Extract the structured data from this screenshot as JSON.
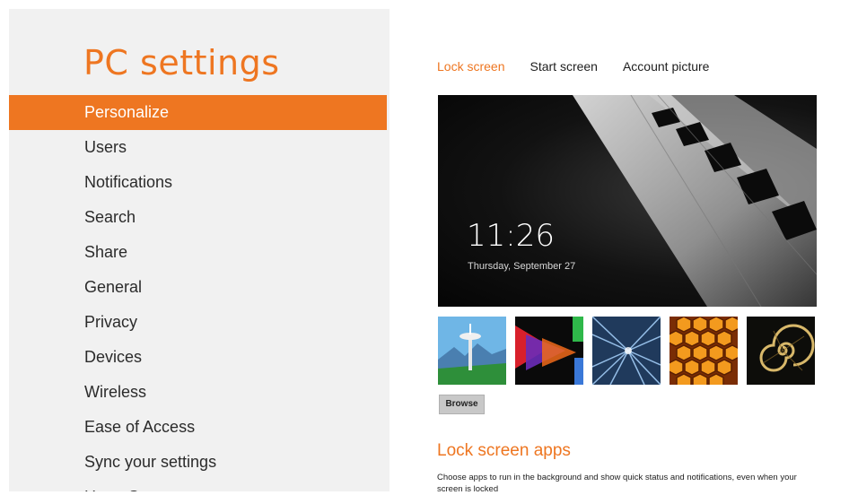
{
  "app": {
    "title": "PC settings"
  },
  "nav": {
    "items": [
      {
        "label": "Personalize",
        "active": true
      },
      {
        "label": "Users"
      },
      {
        "label": "Notifications"
      },
      {
        "label": "Search"
      },
      {
        "label": "Share"
      },
      {
        "label": "General"
      },
      {
        "label": "Privacy"
      },
      {
        "label": "Devices"
      },
      {
        "label": "Wireless"
      },
      {
        "label": "Ease of Access"
      },
      {
        "label": "Sync your settings"
      },
      {
        "label": "HomeGroup"
      }
    ]
  },
  "tabs": [
    {
      "label": "Lock screen",
      "active": true
    },
    {
      "label": "Start screen"
    },
    {
      "label": "Account picture"
    }
  ],
  "lock_preview": {
    "time": "11:26",
    "date": "Thursday, September 27"
  },
  "thumbnails": [
    {
      "name": "space-needle"
    },
    {
      "name": "color-arrows"
    },
    {
      "name": "light-tunnel"
    },
    {
      "name": "honeycomb"
    },
    {
      "name": "nautilus-shell"
    }
  ],
  "browse": {
    "label": "Browse"
  },
  "lock_screen_apps": {
    "title": "Lock screen apps",
    "description": "Choose apps to run in the background and show quick status and notifications, even when your screen is locked"
  },
  "colors": {
    "accent": "#ee7621",
    "nav_bg": "#f1f1f1"
  }
}
